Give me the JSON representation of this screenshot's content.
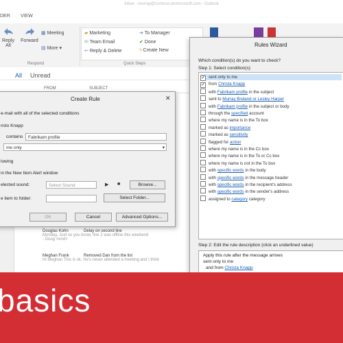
{
  "titlebar": {
    "text": "Inbox - murray@contoso.onmicrosoft.com - Outlook"
  },
  "tabs": [
    "DER",
    "VIEW"
  ],
  "ribbon": {
    "respond": {
      "reply": "Reply All",
      "forward": "Forward",
      "meeting": "Meeting",
      "more": "More",
      "group": "Respond"
    },
    "quicksteps": {
      "items": [
        "Marketing",
        "Team Email",
        "Reply & Delete",
        "To Manager",
        "Done",
        "Create New"
      ],
      "group": "Quick Steps"
    }
  },
  "list": {
    "filter_all": "All",
    "filter_unread": "Unread",
    "col_from": "FROM",
    "col_subject": "SUBJECT",
    "mails": [
      {
        "from": "Douglas Kohn",
        "subject": "Delay on second line",
        "preview": "Monday, Just so you know, line 2 was offline this weekend",
        "sig": "- Doug <end>"
      },
      {
        "from": "Meghan Frank",
        "subject": "Removed Dan from the list",
        "preview": "Hi Meghan This is ok. He's never attended a meeting and I think",
        "sig": ""
      }
    ]
  },
  "create_rule": {
    "title": "Create Rule",
    "conditions_heading": "e-mail with all of the selected conditions",
    "from_label": "risto Knapp",
    "subject_label": "contains",
    "subject_value": "Fabrikam profile",
    "sent_to_value": "me only",
    "do_following": "lowing",
    "alert_label": "in the New Item Alert window",
    "sound_label": "elected sound:",
    "sound_value": "Select Sound",
    "browse": "Browse...",
    "move_label": "e item to folder:",
    "select_folder": "Select Folder...",
    "ok": "OK",
    "cancel": "Cancel",
    "advanced": "Advanced Options..."
  },
  "rules_wizard": {
    "title": "Rules Wizard",
    "question": "Which condition(s) do you want to check?",
    "step1": "Step 1: Select condition(s)",
    "conditions": [
      {
        "pre": "sent only to me",
        "link": "",
        "post": "",
        "checked": true,
        "selected": true
      },
      {
        "pre": "from ",
        "link": "Christa Knapp",
        "post": "",
        "checked": true,
        "selected": false
      },
      {
        "pre": "with ",
        "link": "Fabrikam profile",
        "post": " in the subject",
        "checked": false,
        "selected": false
      },
      {
        "pre": "sent to ",
        "link": "Murray Breland or Lesley Harper",
        "post": "",
        "checked": false,
        "selected": false
      },
      {
        "pre": "with ",
        "link": "Fabrikam profile",
        "post": " in the subject or body",
        "checked": false,
        "selected": false
      },
      {
        "pre": "through the ",
        "link": "specified",
        "post": " account",
        "checked": false,
        "selected": false
      },
      {
        "pre": "where my name is in the To box",
        "link": "",
        "post": "",
        "checked": false,
        "selected": false
      },
      {
        "pre": "marked as ",
        "link": "importance",
        "post": "",
        "checked": false,
        "selected": false
      },
      {
        "pre": "marked as ",
        "link": "sensitivity",
        "post": "",
        "checked": false,
        "selected": false
      },
      {
        "pre": "flagged for ",
        "link": "action",
        "post": "",
        "checked": false,
        "selected": false
      },
      {
        "pre": "where my name is in the Cc box",
        "link": "",
        "post": "",
        "checked": false,
        "selected": false
      },
      {
        "pre": "where my name is in the To or Cc box",
        "link": "",
        "post": "",
        "checked": false,
        "selected": false
      },
      {
        "pre": "where my name is not in the To box",
        "link": "",
        "post": "",
        "checked": false,
        "selected": false
      },
      {
        "pre": "with ",
        "link": "specific words",
        "post": " in the body",
        "checked": false,
        "selected": false
      },
      {
        "pre": "with ",
        "link": "specific words",
        "post": " in the message header",
        "checked": false,
        "selected": false
      },
      {
        "pre": "with ",
        "link": "specific words",
        "post": " in the recipient's address",
        "checked": false,
        "selected": false
      },
      {
        "pre": "with ",
        "link": "specific words",
        "post": " in the sender's address",
        "checked": false,
        "selected": false
      },
      {
        "pre": "assigned to ",
        "link": "category",
        "post": " category",
        "checked": false,
        "selected": false
      }
    ],
    "step2": "Step 2: Edit the rule description (click an underlined value)",
    "desc_line1": "Apply this rule after the message arrives",
    "desc_line2": "sent only to me",
    "desc_line3": "and from ",
    "desc_link": "Christa Knapp"
  },
  "banner": {
    "text": "basics",
    "color": "#d42e35"
  }
}
